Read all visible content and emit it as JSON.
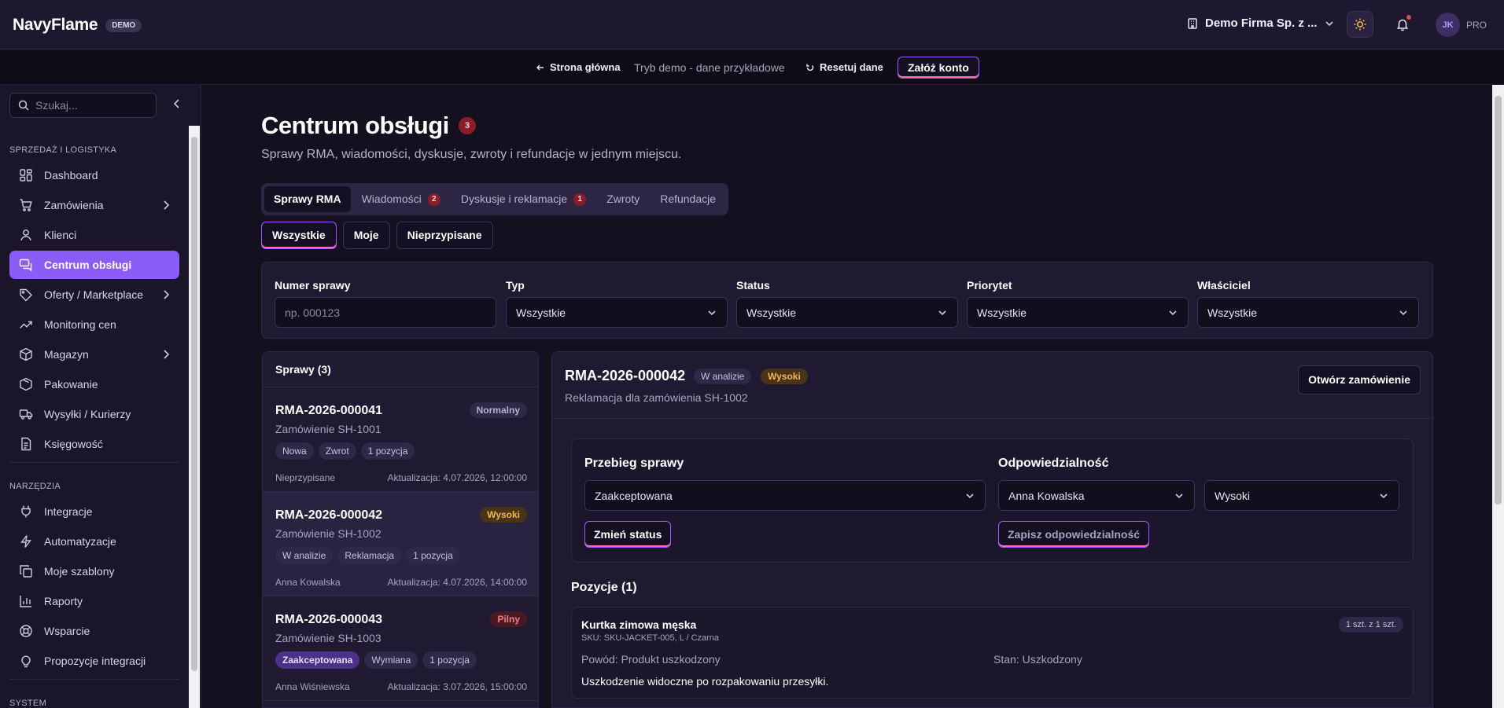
{
  "app": {
    "name": "NavyFlame",
    "badge": "DEMO"
  },
  "header": {
    "company": "Demo Firma Sp. z ...",
    "avatar_initials": "JK",
    "plan": "PRO"
  },
  "demobar": {
    "home": "Strona główna",
    "mode": "Tryb demo - dane przykładowe",
    "reset": "Resetuj dane",
    "register": "Załóż konto"
  },
  "sidebar": {
    "search_placeholder": "Szukaj...",
    "section_sales": "SPRZEDAŻ I LOGISTYKA",
    "section_tools": "NARZĘDZIA",
    "section_system": "SYSTEM",
    "items": [
      {
        "label": "Dashboard"
      },
      {
        "label": "Zamówienia"
      },
      {
        "label": "Klienci"
      },
      {
        "label": "Centrum obsługi"
      },
      {
        "label": "Oferty / Marketplace"
      },
      {
        "label": "Monitoring cen"
      },
      {
        "label": "Magazyn"
      },
      {
        "label": "Pakowanie"
      },
      {
        "label": "Wysyłki / Kurierzy"
      },
      {
        "label": "Księgowość"
      },
      {
        "label": "Integracje"
      },
      {
        "label": "Automatyzacje"
      },
      {
        "label": "Moje szablony"
      },
      {
        "label": "Raporty"
      },
      {
        "label": "Wsparcie"
      },
      {
        "label": "Propozycje integracji"
      }
    ]
  },
  "page": {
    "title": "Centrum obsługi",
    "title_count": "3",
    "subtitle": "Sprawy RMA, wiadomości, dyskusje, zwroty i refundacje w jednym miejscu.",
    "tabs": [
      {
        "label": "Sprawy RMA",
        "badge": ""
      },
      {
        "label": "Wiadomości",
        "badge": "2"
      },
      {
        "label": "Dyskusje i reklamacje",
        "badge": "1"
      },
      {
        "label": "Zwroty",
        "badge": ""
      },
      {
        "label": "Refundacje",
        "badge": ""
      }
    ],
    "quick_filters": [
      "Wszystkie",
      "Moje",
      "Nieprzypisane"
    ]
  },
  "filters": {
    "number_label": "Numer sprawy",
    "number_placeholder": "np. 000123",
    "type_label": "Typ",
    "type_value": "Wszystkie",
    "status_label": "Status",
    "status_value": "Wszystkie",
    "priority_label": "Priorytet",
    "priority_value": "Wszystkie",
    "owner_label": "Właściciel",
    "owner_value": "Wszystkie"
  },
  "cases": {
    "header": "Sprawy (3)",
    "items": [
      {
        "id": "RMA-2026-000041",
        "order": "Zamówienie SH-1001",
        "priority": "Normalny",
        "tags": [
          "Nowa",
          "Zwrot",
          "1 pozycja"
        ],
        "owner": "Nieprzypisane",
        "updated": "Aktualizacja: 4.07.2026, 12:00:00"
      },
      {
        "id": "RMA-2026-000042",
        "order": "Zamówienie SH-1002",
        "priority": "Wysoki",
        "tags": [
          "W analizie",
          "Reklamacja",
          "1 pozycja"
        ],
        "owner": "Anna Kowalska",
        "updated": "Aktualizacja: 4.07.2026, 14:00:00"
      },
      {
        "id": "RMA-2026-000043",
        "order": "Zamówienie SH-1003",
        "priority": "Pilny",
        "tags": [
          "Zaakceptowana",
          "Wymiana",
          "1 pozycja"
        ],
        "owner": "Anna Wiśniewska",
        "updated": "Aktualizacja: 3.07.2026, 15:00:00"
      }
    ]
  },
  "detail": {
    "id": "RMA-2026-000042",
    "status": "W analizie",
    "priority": "Wysoki",
    "subtitle": "Reklamacja dla zamówienia SH-1002",
    "open_order": "Otwórz zamówienie",
    "flow_title": "Przebieg sprawy",
    "flow_status_value": "Zaakceptowana",
    "change_status": "Zmień status",
    "resp_title": "Odpowiedzialność",
    "resp_owner": "Anna Kowalska",
    "resp_priority": "Wysoki",
    "save_resp": "Zapisz odpowiedzialność",
    "positions_title": "Pozycje (1)",
    "position": {
      "name": "Kurtka zimowa męska",
      "sku": "SKU: SKU-JACKET-005, L / Czarna",
      "qty": "1 szt. z 1 szt.",
      "reason": "Powód: Produkt uszkodzony",
      "state": "Stan: Uszkodzony",
      "note": "Uszkodzenie widoczne po rozpakowaniu przesyłki."
    }
  },
  "colors": {
    "accent": "#8b5cf6",
    "badge_red": "#8b1d2a",
    "high": "#f2b458",
    "urgent": "#f27a8a"
  }
}
